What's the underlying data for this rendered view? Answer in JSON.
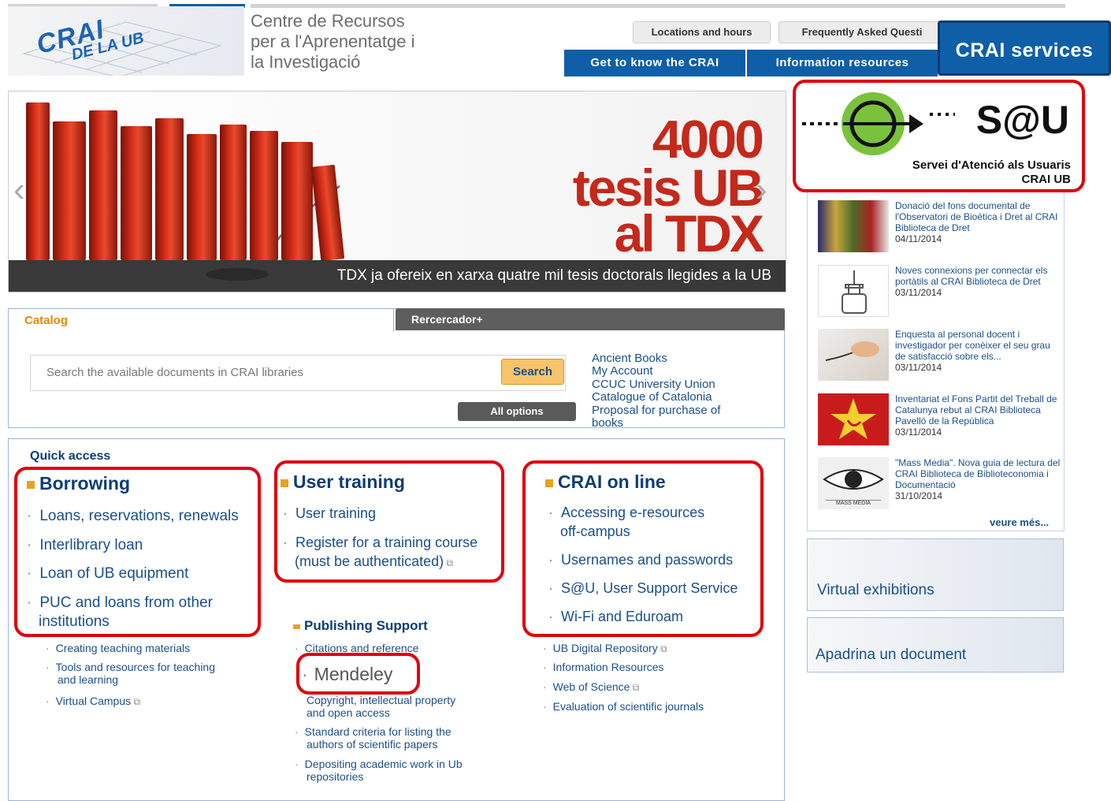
{
  "header": {
    "org_name": "Centre de Recursos\nper a l'Aprenentatge i\nla Investigació",
    "logo_main": "CRAI",
    "logo_sub": "DE LA UB",
    "top_links": [
      "Locations and hours",
      "Frequently Asked Questi"
    ],
    "nav": [
      "Get to know the CRAI",
      "Information resources"
    ],
    "services_button": "CRAI services"
  },
  "banner": {
    "big_line1": "4000",
    "big_line2": "tesis UB",
    "big_line3": "al TDX",
    "caption": "TDX ja ofereix en xarxa quatre mil tesis doctorals llegides a la UB",
    "prev_arrow": "‹",
    "next_arrow": "›"
  },
  "search": {
    "tab_catalog": "Catalog",
    "tab_rercercador": "Rercercador+",
    "placeholder": "Search the available documents in CRAI libraries",
    "search_button": "Search",
    "all_options": "All options",
    "links": [
      "Ancient Books",
      "My Account",
      "CCUC University Union",
      "Catalogue of Catalonia",
      "Proposal for purchase of",
      "books"
    ]
  },
  "quick_access": {
    "title": "Quick access",
    "borrowing": {
      "title": "Borrowing",
      "items": [
        "Loans, reservations, renewals",
        "Interlibrary loan",
        "Loan of UB equipment",
        "PUC and loans from other",
        "institutions"
      ]
    },
    "teaching_items": [
      "Creating teaching materials",
      "Tools and resources for teaching",
      "and learning",
      "Virtual Campus"
    ],
    "user_training": {
      "title": "User training",
      "items": [
        "User training",
        "Register for a training course",
        "(must be authenticated)"
      ]
    },
    "publishing": {
      "title": "Publishing Support",
      "items": [
        "Citations and reference",
        "Mendeley",
        "Copyright, intellectual property",
        "and open access",
        "Standard criteria for listing the",
        "authors of scientific papers",
        "Depositing academic work in Ub",
        "repositories"
      ]
    },
    "crai_online": {
      "title": "CRAI on line",
      "items": [
        "Accessing e-resources",
        "off-campus",
        "Usernames and passwords",
        "S@U, User Support Service",
        "Wi-Fi and Eduroam"
      ]
    },
    "online_small_items": [
      "UB Digital Repository",
      "Information Resources",
      "Web of Science",
      "Evaluation of scientific journals"
    ]
  },
  "sau": {
    "logo_text": "S@U",
    "line1": "Servei d'Atenció als Usuaris",
    "line2": "CRAI UB"
  },
  "news": [
    {
      "text": "Donació del fons documental de l'Observatori de Bioètica i Dret al CRAI Biblioteca de Dret",
      "date": "04/11/2014"
    },
    {
      "text": "Noves connexions per connectar els portàtils al CRAI Biblioteca de Dret",
      "date": "03/11/2014"
    },
    {
      "text": "Enquesta al personal docent i investigador per conèixer el seu grau de satisfacció sobre els...",
      "date": "03/11/2014"
    },
    {
      "text": "Inventariat el Fons Partit del Treball de Catalunya rebut al CRAI Biblioteca Pavelló de la República",
      "date": "03/11/2014"
    },
    {
      "text": "\"Mass Media\". Nova guia de lectura del CRAI Biblioteca de Biblioteconomia i Documentació",
      "date": "31/10/2014"
    }
  ],
  "news_more": "veure més...",
  "thumb4_caption": "MASS MEDIA",
  "promos": [
    "Virtual exhibitions",
    "Apadrina un document"
  ],
  "colors": {
    "primary": "#0e5fa8",
    "accent": "#e9a122",
    "highlight": "#e0000f"
  }
}
